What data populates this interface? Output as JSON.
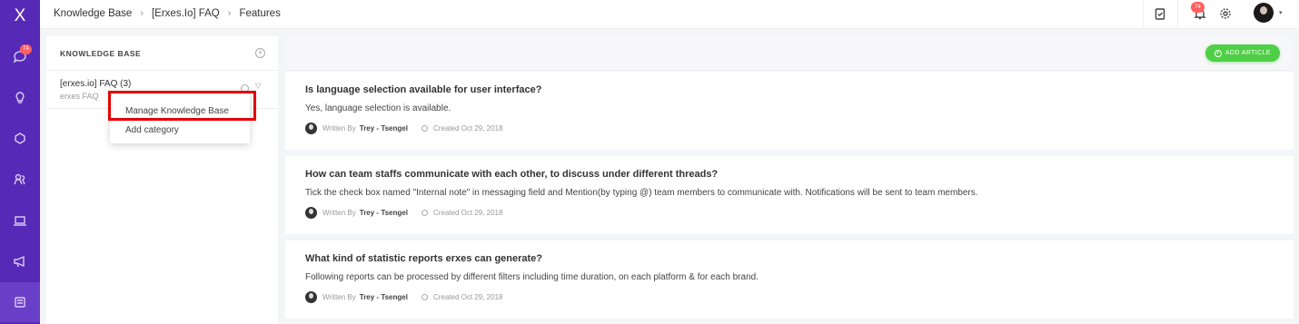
{
  "nav": {
    "logo": "X",
    "inbox_badge": "74",
    "items": [
      "inbox-icon",
      "bulb-icon",
      "chat-bubble-icon",
      "users-icon",
      "laptop-icon",
      "megaphone-icon",
      "knowledge-base-icon"
    ]
  },
  "topbar": {
    "breadcrumb": [
      "Knowledge Base",
      "[Erxes.Io] FAQ",
      "Features"
    ],
    "notification_badge": "74"
  },
  "sidebar": {
    "title": "KNOWLEDGE BASE",
    "kb_name": "[erxes.io] FAQ (3)",
    "kb_desc": "erxes FAQ",
    "dropdown": {
      "manage": "Manage Knowledge Base",
      "add_category": "Add category"
    }
  },
  "main": {
    "add_article": "ADD ARTICLE",
    "written_by": "Written By",
    "articles": [
      {
        "title": "Is language selection available for user interface?",
        "body": "Yes, language selection is available.",
        "author": "Trey - Tsengel",
        "created": "Created Oct 29, 2018"
      },
      {
        "title": "How can team staffs communicate with each other, to discuss under different threads?",
        "body": "Tick the check box named \"Internal note\" in messaging field and Mention(by typing @) team members to communicate with. Notifications will be sent to team members.",
        "author": "Trey - Tsengel",
        "created": "Created Oct 29, 2018"
      },
      {
        "title": "What kind of statistic reports erxes can generate?",
        "body": "Following reports can be processed by different filters including time duration, on each platform & for each brand.",
        "author": "Trey - Tsengel",
        "created": "Created Oct 29, 2018"
      }
    ]
  },
  "colors": {
    "nav_bg": "#5629b6",
    "accent_green": "#4fcf45",
    "badge_red": "#ff5f5f",
    "highlight_red": "#e40000"
  }
}
